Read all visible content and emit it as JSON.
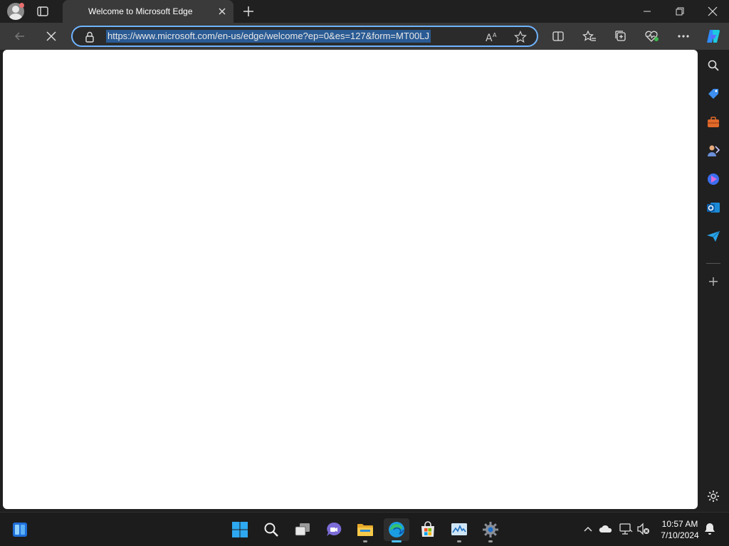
{
  "window": {
    "tab_title": "Welcome to Microsoft Edge",
    "minimize_icon": "minimize-icon",
    "restore_icon": "restore-icon",
    "close_icon": "close-icon"
  },
  "toolbar": {
    "url": "https://www.microsoft.com/en-us/edge/welcome?ep=0&es=127&form=MT00LJ",
    "icons": [
      "back-arrow-icon",
      "stop-loading-icon",
      "lock-icon",
      "read-aloud-icon",
      "favorite-star-icon",
      "split-screen-icon",
      "favorites-icon",
      "collections-icon",
      "browser-essentials-icon",
      "more-icon",
      "copilot-icon"
    ]
  },
  "sidebar": {
    "items": [
      "search-icon",
      "shopping-icon",
      "tools-icon",
      "games-icon",
      "copilot-app-icon",
      "outlook-icon",
      "drop-icon",
      "add-icon",
      "settings-icon"
    ]
  },
  "taskbar": {
    "apps": [
      "widgets-icon",
      "start-icon",
      "search-icon",
      "task-view-icon",
      "teams-chat-icon",
      "file-explorer-icon",
      "edge-icon",
      "store-icon",
      "task-manager-icon",
      "settings-gear-icon"
    ],
    "time": "10:57 AM",
    "date": "7/10/2024",
    "accent": "#4cc2ff"
  },
  "colors": {
    "address_border": "#6fb4ff",
    "url_highlight": "#2a5b94"
  }
}
